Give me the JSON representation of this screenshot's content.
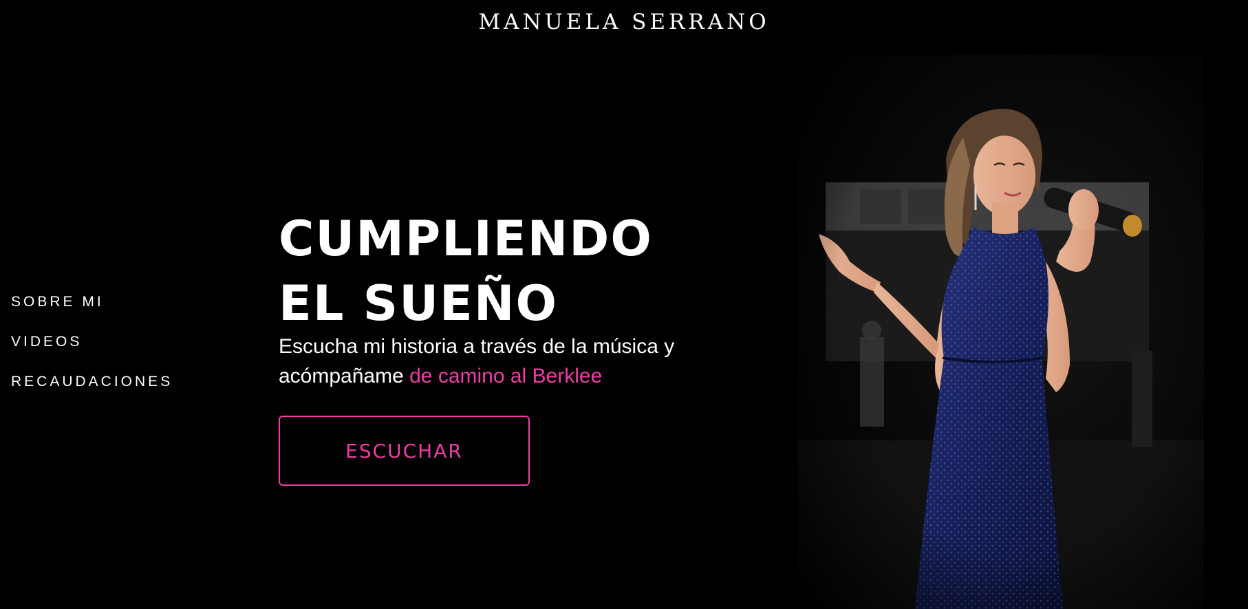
{
  "brand": {
    "name": "MANUELA SERRANO"
  },
  "nav": {
    "items": [
      {
        "label": "SOBRE MI"
      },
      {
        "label": "VIDEOS"
      },
      {
        "label": "RECAUDACIONES"
      }
    ]
  },
  "hero": {
    "title_line1": "CUMPLIENDO",
    "title_line2": "EL SUEÑO",
    "subtitle_line1": "Escucha mi historia a través de la música y",
    "subtitle_line2_plain": "acómpañame ",
    "subtitle_line2_accent": "de camino al Berklee",
    "cta_label": "ESCUCHAR"
  },
  "colors": {
    "background": "#000000",
    "text": "#ffffff",
    "accent": "#ee3ea5",
    "dress": "#1b2460"
  }
}
